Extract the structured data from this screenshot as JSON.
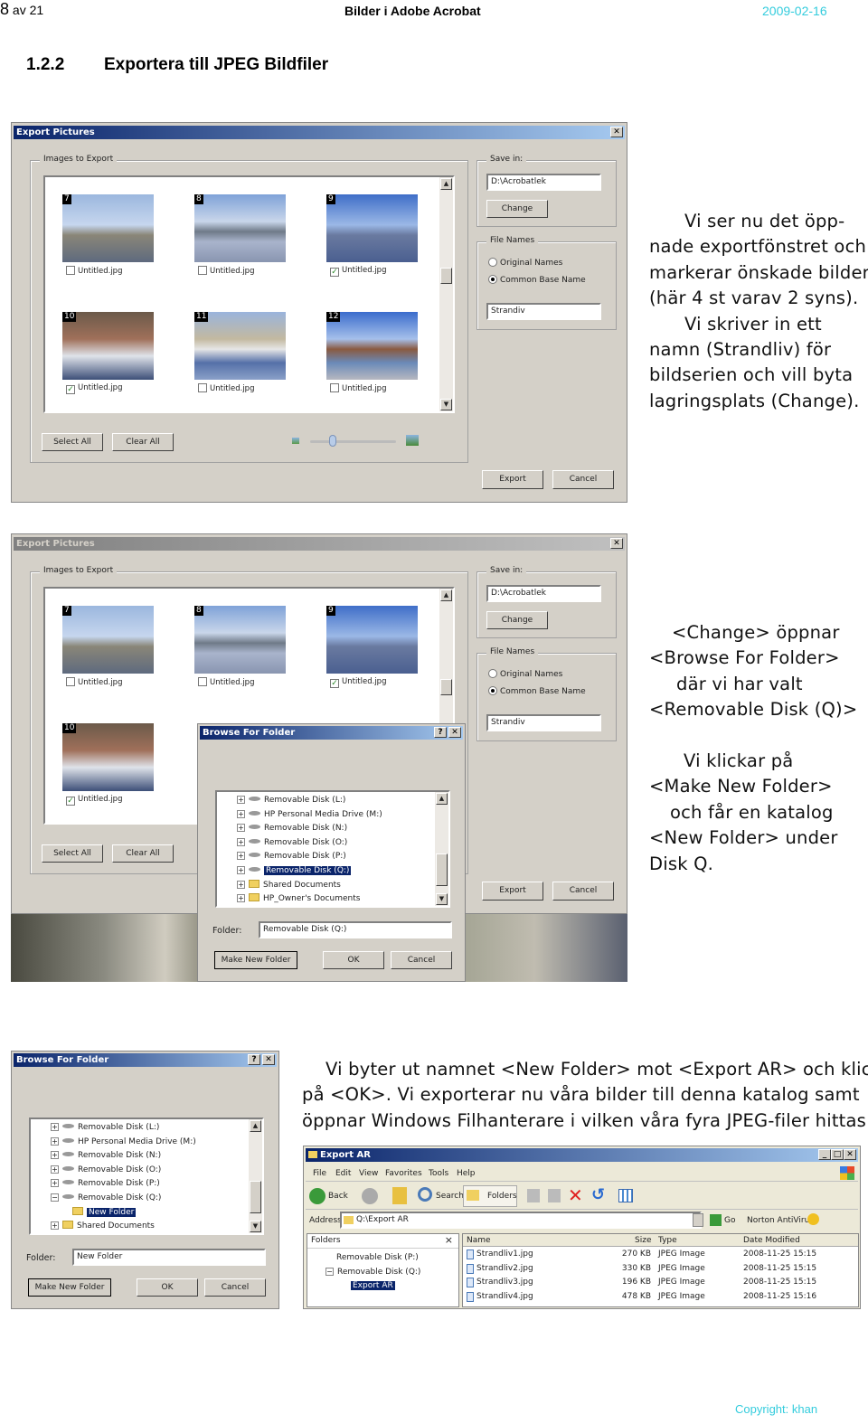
{
  "header": {
    "page_num": "8",
    "page_of": "av 21",
    "title": "Bilder i Adobe Acrobat",
    "date": "2009-02-16",
    "date_color": "#33ccdd"
  },
  "section": {
    "number": "1.2.2",
    "title": "Exportera till JPEG Bildfiler"
  },
  "dialog1": {
    "title": "Export Pictures",
    "close": "✕",
    "images_group": "Images to Export",
    "thumbs": [
      {
        "num": "7",
        "label": "Untitled.jpg",
        "checked": false
      },
      {
        "num": "8",
        "label": "Untitled.jpg",
        "checked": false
      },
      {
        "num": "9",
        "label": "Untitled.jpg",
        "checked": true
      },
      {
        "num": "10",
        "label": "Untitled.jpg",
        "checked": true
      },
      {
        "num": "11",
        "label": "Untitled.jpg",
        "checked": false
      },
      {
        "num": "12",
        "label": "Untitled.jpg",
        "checked": false
      }
    ],
    "select_all": "Select All",
    "clear_all": "Clear All",
    "save_in_label": "Save in:",
    "save_path": "D:\\Acrobatlek",
    "change": "Change",
    "file_names_label": "File Names",
    "radio_original": "Original Names",
    "radio_common": "Common Base Name",
    "base_name": "Strandiv",
    "export": "Export",
    "cancel": "Cancel",
    "active": true
  },
  "dialog2": {
    "title": "Export Pictures",
    "close": "✕",
    "images_group": "Images to Export",
    "thumbs": [
      {
        "num": "7",
        "label": "Untitled.jpg",
        "checked": false
      },
      {
        "num": "8",
        "label": "Untitled.jpg",
        "checked": false
      },
      {
        "num": "9",
        "label": "Untitled.jpg",
        "checked": true
      },
      {
        "num": "10",
        "label": "Untitled.jpg",
        "checked": true
      }
    ],
    "select_all": "Select All",
    "clear_all": "Clear All",
    "save_in_label": "Save in:",
    "save_path": "D:\\Acrobatlek",
    "change": "Change",
    "file_names_label": "File Names",
    "radio_original": "Original Names",
    "radio_common": "Common Base Name",
    "base_name": "Strandiv",
    "export": "Export",
    "cancel": "Cancel",
    "active": false
  },
  "browse1": {
    "title": "Browse For Folder",
    "help": "?",
    "close": "✕",
    "items": [
      {
        "label": "Removable Disk (L:)",
        "icon": "drive",
        "pm": "+",
        "indent": 0
      },
      {
        "label": "HP Personal Media Drive (M:)",
        "icon": "drive",
        "pm": "+",
        "indent": 0
      },
      {
        "label": "Removable Disk (N:)",
        "icon": "drive",
        "pm": "+",
        "indent": 0
      },
      {
        "label": "Removable Disk (O:)",
        "icon": "drive",
        "pm": "+",
        "indent": 0
      },
      {
        "label": "Removable Disk (P:)",
        "icon": "drive",
        "pm": "+",
        "indent": 0
      },
      {
        "label": "Removable Disk (Q:)",
        "icon": "drive",
        "pm": "+",
        "indent": 0,
        "selected": true
      },
      {
        "label": "Shared Documents",
        "icon": "folder",
        "pm": "+",
        "indent": 0
      },
      {
        "label": "HP_Owner's Documents",
        "icon": "folder",
        "pm": "+",
        "indent": 0
      }
    ],
    "folder_label": "Folder:",
    "folder_value": "Removable Disk (Q:)",
    "make_new_folder": "Make New Folder",
    "ok": "OK",
    "cancel": "Cancel"
  },
  "browse2": {
    "title": "Browse For Folder",
    "help": "?",
    "close": "✕",
    "items": [
      {
        "label": "Removable Disk (L:)",
        "icon": "drive",
        "pm": "+",
        "indent": 0
      },
      {
        "label": "HP Personal Media Drive (M:)",
        "icon": "drive",
        "pm": "+",
        "indent": 0
      },
      {
        "label": "Removable Disk (N:)",
        "icon": "drive",
        "pm": "+",
        "indent": 0
      },
      {
        "label": "Removable Disk (O:)",
        "icon": "drive",
        "pm": "+",
        "indent": 0
      },
      {
        "label": "Removable Disk (P:)",
        "icon": "drive",
        "pm": "+",
        "indent": 0
      },
      {
        "label": "Removable Disk (Q:)",
        "icon": "drive",
        "pm": "−",
        "indent": 0
      },
      {
        "label": "New Folder",
        "icon": "folder",
        "pm": "",
        "indent": 1,
        "selected": true
      },
      {
        "label": "Shared Documents",
        "icon": "folder",
        "pm": "+",
        "indent": 0
      }
    ],
    "folder_label": "Folder:",
    "folder_value": "New Folder",
    "make_new_folder": "Make New Folder",
    "ok": "OK",
    "cancel": "Cancel"
  },
  "explorer": {
    "title": "Export AR",
    "menu": [
      "File",
      "Edit",
      "View",
      "Favorites",
      "Tools",
      "Help"
    ],
    "back": "Back",
    "search": "Search",
    "folders": "Folders",
    "address_label": "Address",
    "address": "Q:\\Export AR",
    "go": "Go",
    "norton": "Norton AntiVirus",
    "folders_header": "Folders",
    "folders_close": "×",
    "tree": [
      {
        "label": "Removable Disk (P:)",
        "pm": ""
      },
      {
        "label": "Removable Disk (Q:)",
        "pm": "−"
      },
      {
        "label": "Export AR",
        "pm": "",
        "selected": true
      }
    ],
    "columns": {
      "name": "Name",
      "size": "Size",
      "type": "Type",
      "date": "Date Modified"
    },
    "files": [
      {
        "name": "Strandliv1.jpg",
        "size": "270 KB",
        "type": "JPEG Image",
        "date": "2008-11-25 15:15"
      },
      {
        "name": "Strandliv2.jpg",
        "size": "330 KB",
        "type": "JPEG Image",
        "date": "2008-11-25 15:15"
      },
      {
        "name": "Strandliv3.jpg",
        "size": "196 KB",
        "type": "JPEG Image",
        "date": "2008-11-25 15:15"
      },
      {
        "name": "Strandliv4.jpg",
        "size": "478 KB",
        "type": "JPEG Image",
        "date": "2008-11-25 15:16"
      }
    ]
  },
  "text1": [
    "Vi ser nu det öpp-",
    "nade exportfönstret och",
    "markerar önskade bilder",
    "(här 4 st varav 2 syns).",
    "Vi skriver in ett",
    "namn (Strandliv) för",
    "bildserien och vill byta",
    "lagringsplats (Change)."
  ],
  "text2": [
    "<Change> öppnar",
    "<Browse For Folder>",
    "där vi har valt",
    "<Removable Disk (Q)>"
  ],
  "text3": [
    "Vi klickar på",
    "<Make New Folder>",
    "och får en katalog",
    "<New Folder> under",
    "Disk Q."
  ],
  "text4": [
    "Vi byter ut namnet <New Folder> mot <Export AR> och klickar",
    "på <OK>. Vi exporterar nu våra bilder till denna katalog samt",
    "öppnar Windows Filhanterare i vilken våra fyra JPEG-filer hittas."
  ],
  "footer": {
    "copyright": "Copyright:  khan"
  }
}
